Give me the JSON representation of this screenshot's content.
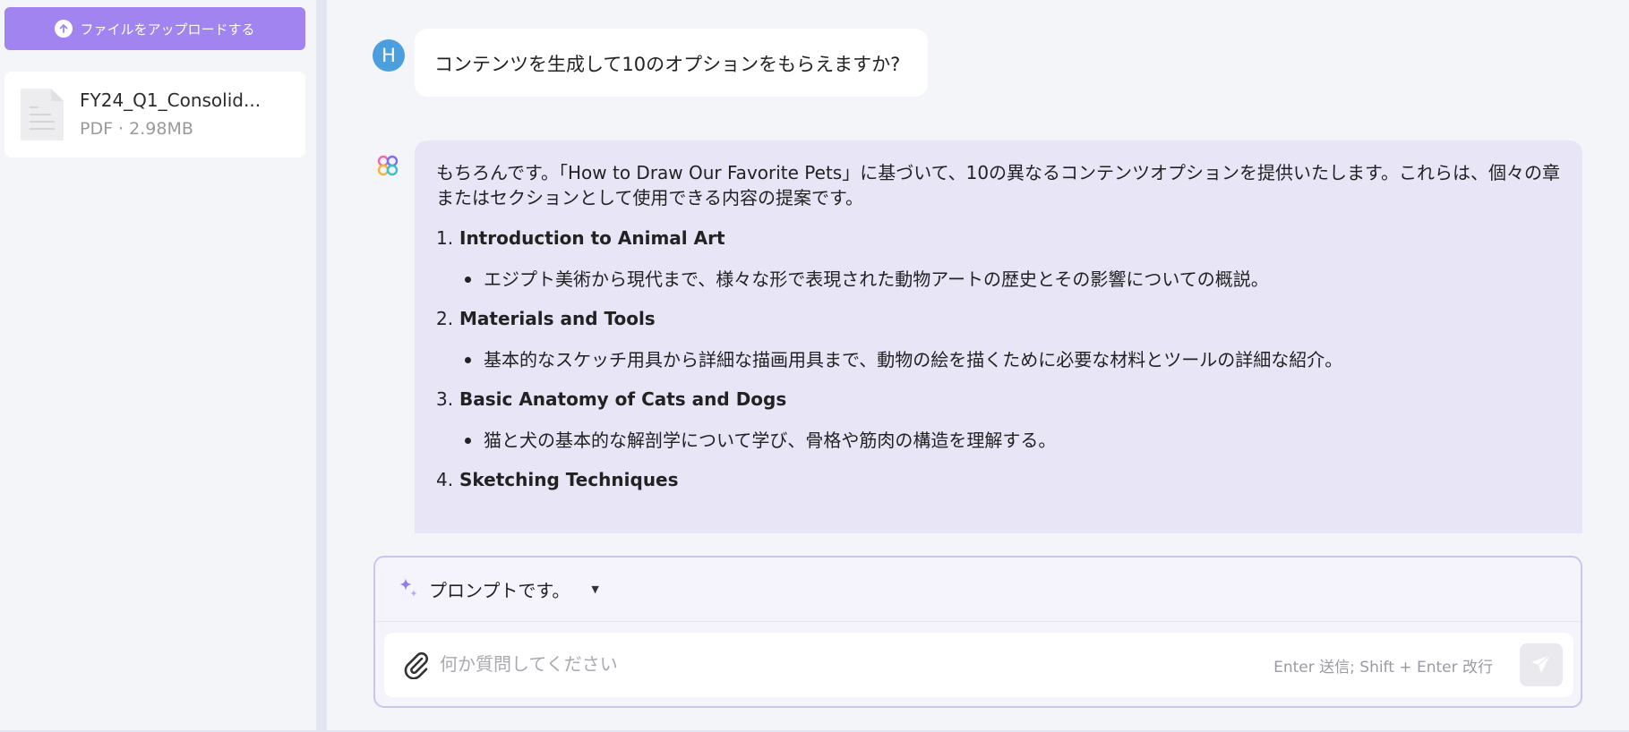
{
  "sidebar": {
    "upload_label": "ファイルをアップロードする",
    "file": {
      "name": "FY24_Q1_Consolid...",
      "meta": "PDF · 2.98MB"
    }
  },
  "chat": {
    "user": {
      "avatar_letter": "H",
      "message": "コンテンツを生成して10のオプションをもらえますか?"
    },
    "ai": {
      "intro": "もちろんです。「How to Draw Our Favorite Pets」に基づいて、10の異なるコンテンツオプションを提供いたします。これらは、個々の章またはセクションとして使用できる内容の提案です。",
      "items": [
        {
          "num": "1.",
          "title": "Introduction to Animal Art",
          "desc": "エジプト美術から現代まで、様々な形で表現された動物アートの歴史とその影響についての概説。"
        },
        {
          "num": "2.",
          "title": "Materials and Tools",
          "desc": "基本的なスケッチ用具から詳細な描画用具まで、動物の絵を描くために必要な材料とツールの詳細な紹介。"
        },
        {
          "num": "3.",
          "title": "Basic Anatomy of Cats and Dogs",
          "desc": "猫と犬の基本的な解剖学について学び、骨格や筋肉の構造を理解する。"
        },
        {
          "num": "4.",
          "title": "Sketching Techniques",
          "desc": ""
        }
      ]
    }
  },
  "composer": {
    "prompt_label": "プロンプトです。",
    "placeholder": "何か質問してください",
    "hint": "Enter 送信; Shift + Enter 改行"
  },
  "colors": {
    "accent": "#a184f0",
    "user_avatar": "#4a9fdc",
    "ai_bubble": "#e8e5f7"
  }
}
